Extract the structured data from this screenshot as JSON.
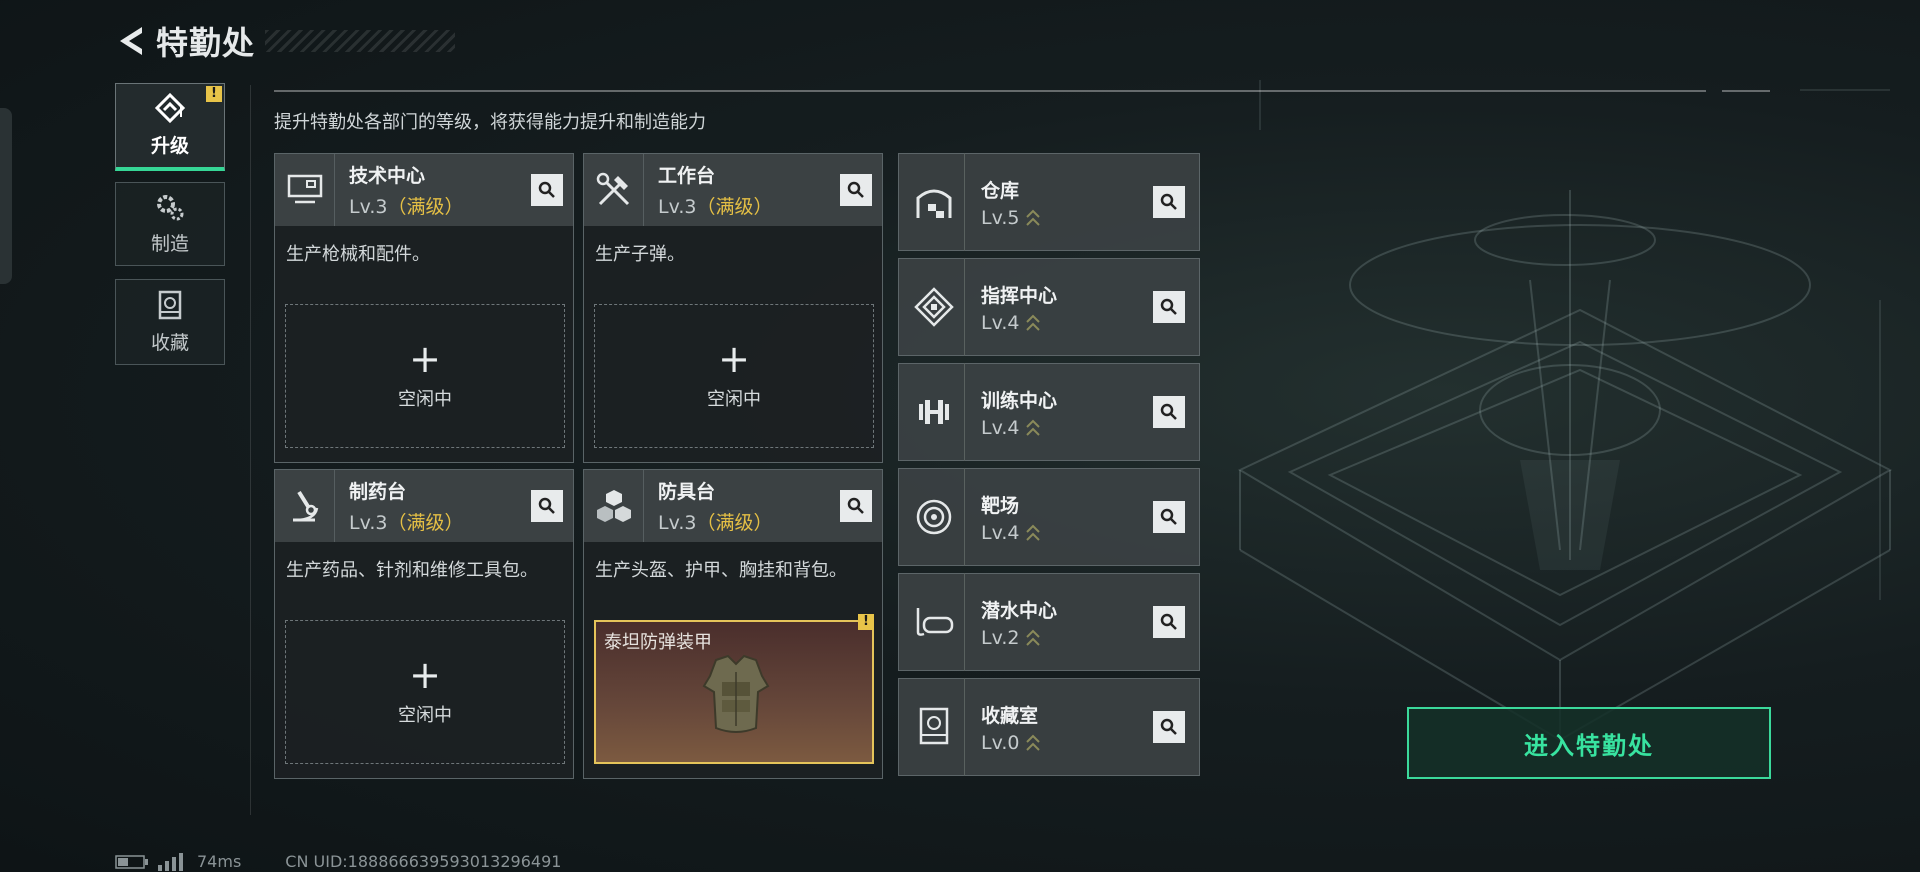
{
  "header": {
    "title": "特勤处"
  },
  "nav": [
    {
      "label": "升级",
      "icon": "upgrade-icon",
      "active": true,
      "badge": "!"
    },
    {
      "label": "制造",
      "icon": "gears-icon",
      "active": false
    },
    {
      "label": "收藏",
      "icon": "collection-icon",
      "active": false
    }
  ],
  "subtitle": "提升特勤处各部门的等级，将获得能力提升和制造能力",
  "departments": [
    {
      "name": "技术中心",
      "level": "Lv.3",
      "max_tag": "（满级）",
      "desc": "生产枪械和配件。",
      "slot": {
        "plus": "+",
        "status": "空闲中"
      }
    },
    {
      "name": "工作台",
      "level": "Lv.3",
      "max_tag": "（满级）",
      "desc": "生产子弹。",
      "slot": {
        "plus": "+",
        "status": "空闲中"
      }
    },
    {
      "name": "制药台",
      "level": "Lv.3",
      "max_tag": "（满级）",
      "desc": "生产药品、针剂和维修工具包。",
      "slot": {
        "plus": "+",
        "status": "空闲中"
      }
    },
    {
      "name": "防具台",
      "level": "Lv.3",
      "max_tag": "（满级）",
      "desc": "生产头盔、护甲、胸挂和背包。",
      "slot_item": {
        "name": "泰坦防弹装甲",
        "badge": "!"
      }
    }
  ],
  "facilities": [
    {
      "name": "仓库",
      "level": "Lv.5",
      "icon": "warehouse-icon"
    },
    {
      "name": "指挥中心",
      "level": "Lv.4",
      "icon": "command-center-icon"
    },
    {
      "name": "训练中心",
      "level": "Lv.4",
      "icon": "dumbbell-icon"
    },
    {
      "name": "靶场",
      "level": "Lv.4",
      "icon": "target-icon"
    },
    {
      "name": "潜水中心",
      "level": "Lv.2",
      "icon": "diving-mask-icon"
    },
    {
      "name": "收藏室",
      "level": "Lv.0",
      "icon": "collection-room-icon"
    }
  ],
  "enter_button": "进入特勤处",
  "footer": {
    "ping": "74ms",
    "uid": "CN UID:1888666395930132964‍91"
  },
  "colors": {
    "accent": "#36d696",
    "max_level": "#e4bf45",
    "badge": "#e8c449"
  }
}
